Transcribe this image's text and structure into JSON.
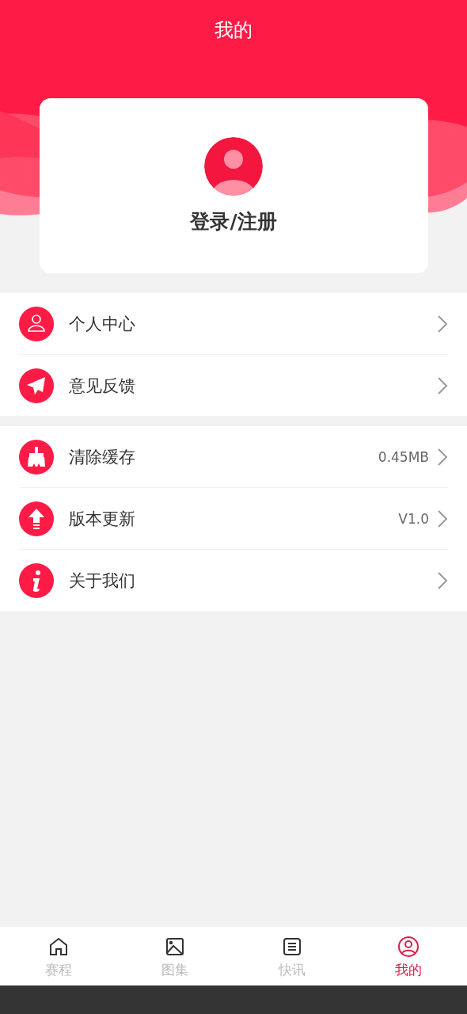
{
  "header": {
    "title": "我的"
  },
  "profile": {
    "login_label": "登录/注册"
  },
  "menu_groups": [
    {
      "items": [
        {
          "label": "个人中心"
        },
        {
          "label": "意见反馈"
        }
      ]
    },
    {
      "items": [
        {
          "label": "清除缓存",
          "value": "0.45MB"
        },
        {
          "label": "版本更新",
          "value": "V1.0"
        },
        {
          "label": "关于我们"
        }
      ]
    }
  ],
  "tabs": [
    {
      "label": "赛程",
      "selected": false
    },
    {
      "label": "图集",
      "selected": false
    },
    {
      "label": "快讯",
      "selected": false
    },
    {
      "label": "我的",
      "selected": true
    }
  ]
}
